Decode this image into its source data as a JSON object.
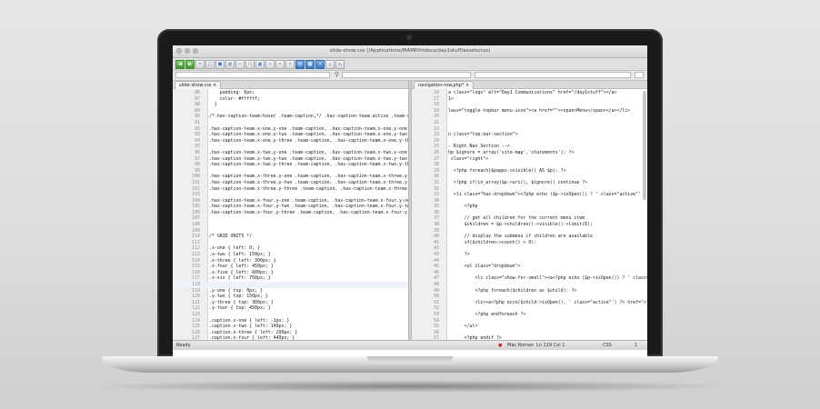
{
  "window": {
    "title": "slide-show.css (/Applications/MAMP/htdocs/day1stuff/assets/css)"
  },
  "toolbar": {
    "icons": [
      "back-icon",
      "forward-icon",
      "new-icon",
      "open-icon",
      "save-icon",
      "print-icon",
      "cut-icon",
      "copy-icon",
      "paste-icon",
      "undo-icon",
      "redo-icon",
      "find-icon",
      "globe-icon",
      "preview-icon",
      "upload-icon",
      "download-icon",
      "sync-icon"
    ]
  },
  "left_pane": {
    "tab": "slide-show.css",
    "lines": [
      {
        "n": "86",
        "t": "    padding: 6px;",
        "c": "red-t"
      },
      {
        "n": "87",
        "t": "    color: #ffffff;",
        "c": "red-t"
      },
      {
        "n": "88",
        "t": "  }",
        "c": ""
      },
      {
        "n": "89",
        "t": "",
        "c": ""
      },
      {
        "n": "90",
        "t": "/*.has-caption-team:hover .team-caption,*/ .has-caption-team.active .team-caption {",
        "c": "green-t"
      },
      {
        "n": "91",
        "t": "",
        "c": ""
      },
      {
        "n": "92",
        "t": ".has-caption-team.x-one.y-one .team-caption, .has-caption-team.x-one.y-one:hover .te",
        "c": "green-t"
      },
      {
        "n": "93",
        "t": ".has-caption-team.x-one.y-two .team-caption, .has-caption-team.x-one.y-two:hover .te",
        "c": "green-t"
      },
      {
        "n": "94",
        "t": ".has-caption-team.x-one.y-three .team-caption, .has-caption-team.x-one.y-three:hove",
        "c": "green-t"
      },
      {
        "n": "95",
        "t": "",
        "c": ""
      },
      {
        "n": "96",
        "t": ".has-caption-team.x-two.y-one .team-caption, .has-caption-team.x-two.y-one:hover .te",
        "c": "green-t"
      },
      {
        "n": "97",
        "t": ".has-caption-team.x-two.y-two .team-caption, .has-caption-team.x-two.y-two:hover .te",
        "c": "green-t"
      },
      {
        "n": "98",
        "t": ".has-caption-team.x-two.y-three .team-caption, .has-caption-team.x-two.y-three:hover",
        "c": "green-t"
      },
      {
        "n": "99",
        "t": "",
        "c": ""
      },
      {
        "n": "100",
        "t": ".has-caption-team.x-three.y-one .team-caption, .has-caption-team.x-three.y-one:hover",
        "c": "green-t"
      },
      {
        "n": "101",
        "t": ".has-caption-team.x-three.y-two .team-caption, .has-caption-team.x-three.y-two:hover",
        "c": "green-t"
      },
      {
        "n": "102",
        "t": ".has-caption-team.x-three.y-three .team-caption, .has-caption-team.x-three.y-three:h",
        "c": "green-t"
      },
      {
        "n": "103",
        "t": "",
        "c": ""
      },
      {
        "n": "104",
        "t": ".has-caption-team.x-four.y-one .team-caption, .has-caption-team.x-four.y-one:hover .",
        "c": "green-t"
      },
      {
        "n": "105",
        "t": ".has-caption-team.x-four.y-two .team-caption, .has-caption-team.x-four.y-two:hover .",
        "c": "green-t"
      },
      {
        "n": "106",
        "t": ".has-caption-team.x-four.y-three .team-caption, .has-caption-team.x-four.y-three:hov",
        "c": "green-t"
      },
      {
        "n": "107",
        "t": "",
        "c": ""
      },
      {
        "n": "108",
        "t": "",
        "c": ""
      },
      {
        "n": "109",
        "t": "",
        "c": ""
      },
      {
        "n": "110",
        "t": "/* GRID UNITS */",
        "c": "gray-t"
      },
      {
        "n": "111",
        "t": "",
        "c": ""
      },
      {
        "n": "112",
        "t": ".x-one { left: 0; }",
        "c": "green-t"
      },
      {
        "n": "113",
        "t": ".x-two { left: 150px; }",
        "c": "green-t"
      },
      {
        "n": "114",
        "t": ".x-three { left: 300px; }",
        "c": "green-t"
      },
      {
        "n": "115",
        "t": ".x-four { left: 450px; }",
        "c": "green-t"
      },
      {
        "n": "116",
        "t": ".x-five { left: 600px; }",
        "c": "green-t"
      },
      {
        "n": "117",
        "t": ".x-six { left: 750px; }",
        "c": "green-t"
      },
      {
        "n": "118",
        "t": "",
        "c": "",
        "hl": true
      },
      {
        "n": "119",
        "t": ".y-one { top: 0px; }",
        "c": "green-t"
      },
      {
        "n": "120",
        "t": ".y-two { top: 150px; }",
        "c": "green-t"
      },
      {
        "n": "121",
        "t": ".y-three { top: 300px; }",
        "c": "green-t"
      },
      {
        "n": "122",
        "t": ".y-four { top: 450px; }",
        "c": "green-t"
      },
      {
        "n": "123",
        "t": "",
        "c": ""
      },
      {
        "n": "124",
        "t": ".caption.x-one { left: -1px; }",
        "c": "green-t"
      },
      {
        "n": "125",
        "t": ".caption.x-two { left: 149px; }",
        "c": "green-t"
      },
      {
        "n": "126",
        "t": ".caption.x-three { left: 299px; }",
        "c": "green-t"
      },
      {
        "n": "127",
        "t": ".caption.x-four { left: 449px; }",
        "c": "green-t"
      }
    ]
  },
  "right_pane": {
    "tab": "navigation-row.php*",
    "lines": [
      {
        "n": "16",
        "t": "a class=\"logo\" alt=\"Day1 Communications\" href=\"/day1stuff\"></a>",
        "c": "blue-t"
      },
      {
        "n": "17",
        "t": "1>",
        "c": "blue-t"
      },
      {
        "n": "18",
        "t": "",
        "c": ""
      },
      {
        "n": "19",
        "t": "lass=\"toggle-topbar menu-icon\"><a href=\"\"><span>Menu</span></a></li>",
        "c": "blue-t"
      },
      {
        "n": "20",
        "t": "",
        "c": ""
      },
      {
        "n": "21",
        "t": "",
        "c": ""
      },
      {
        "n": "22",
        "t": "",
        "c": ""
      },
      {
        "n": "23",
        "t": "n class=\"top-bar-section\">",
        "c": "blue-t"
      },
      {
        "n": "24",
        "t": "",
        "c": ""
      },
      {
        "n": "25",
        "t": "- Right Nav Section -->",
        "c": "gray-t"
      },
      {
        "n": "26",
        "t": "hp $ignore = array('site-map','statements'); ?>",
        "c": "purple-t"
      },
      {
        "n": "27",
        "t": " class=\"right\">",
        "c": "blue-t"
      },
      {
        "n": "28",
        "t": "",
        "c": ""
      },
      {
        "n": "29",
        "t": "  <?php foreach($pages->visible() AS $p): ?>",
        "c": "purple-t"
      },
      {
        "n": "30",
        "t": "",
        "c": ""
      },
      {
        "n": "31",
        "t": "  <?php if(in_array($p->uri(), $ignore)) continue ?>",
        "c": "purple-t"
      },
      {
        "n": "32",
        "t": "",
        "c": ""
      },
      {
        "n": "33",
        "t": "  <li class=\"has-dropdown\"><?php echo ($p->isOpen()) ? ' class=\"active\"' : '' ?> hr",
        "c": "blue-t"
      },
      {
        "n": "34",
        "t": "",
        "c": ""
      },
      {
        "n": "35",
        "t": "      <?php",
        "c": "purple-t"
      },
      {
        "n": "36",
        "t": "",
        "c": ""
      },
      {
        "n": "37",
        "t": "      // get all children for the current menu item",
        "c": "gray-t"
      },
      {
        "n": "38",
        "t": "      $children = $p->children()->visible()->limit(6);",
        "c": "purple-t"
      },
      {
        "n": "39",
        "t": "",
        "c": ""
      },
      {
        "n": "40",
        "t": "      // display the submenu if children are available",
        "c": "gray-t"
      },
      {
        "n": "41",
        "t": "      if($children->count() > 0):",
        "c": "purple-t"
      },
      {
        "n": "42",
        "t": "",
        "c": ""
      },
      {
        "n": "43",
        "t": "      ?>",
        "c": "purple-t"
      },
      {
        "n": "44",
        "t": "",
        "c": ""
      },
      {
        "n": "45",
        "t": "      <ul class=\"dropdown\">",
        "c": "blue-t"
      },
      {
        "n": "46",
        "t": "",
        "c": ""
      },
      {
        "n": "47",
        "t": "          <li class=\"show-for-small\"><a<?php echo ($p->isOpen()) ? ' class=\"active\"'",
        "c": "blue-t"
      },
      {
        "n": "48",
        "t": "",
        "c": ""
      },
      {
        "n": "49",
        "t": "          <?php foreach($children as $child): ?>",
        "c": "purple-t"
      },
      {
        "n": "50",
        "t": "",
        "c": ""
      },
      {
        "n": "51",
        "t": "          <li><a<?php ecco($child->isOpen(), ' class=\"active\"') ?> href=\"<?php echo $",
        "c": "blue-t"
      },
      {
        "n": "52",
        "t": "",
        "c": ""
      },
      {
        "n": "53",
        "t": "          <?php endforeach ?>",
        "c": "purple-t"
      },
      {
        "n": "54",
        "t": "",
        "c": ""
      },
      {
        "n": "55",
        "t": "      </ul>",
        "c": "blue-t"
      },
      {
        "n": "56",
        "t": "",
        "c": ""
      },
      {
        "n": "57",
        "t": "      <?php endif ?>",
        "c": "purple-t"
      }
    ]
  },
  "status": {
    "left": "Ready",
    "encoding": "Mac Roman",
    "position": "Ln 119 Col 1",
    "language": "CSS",
    "page": "1"
  }
}
